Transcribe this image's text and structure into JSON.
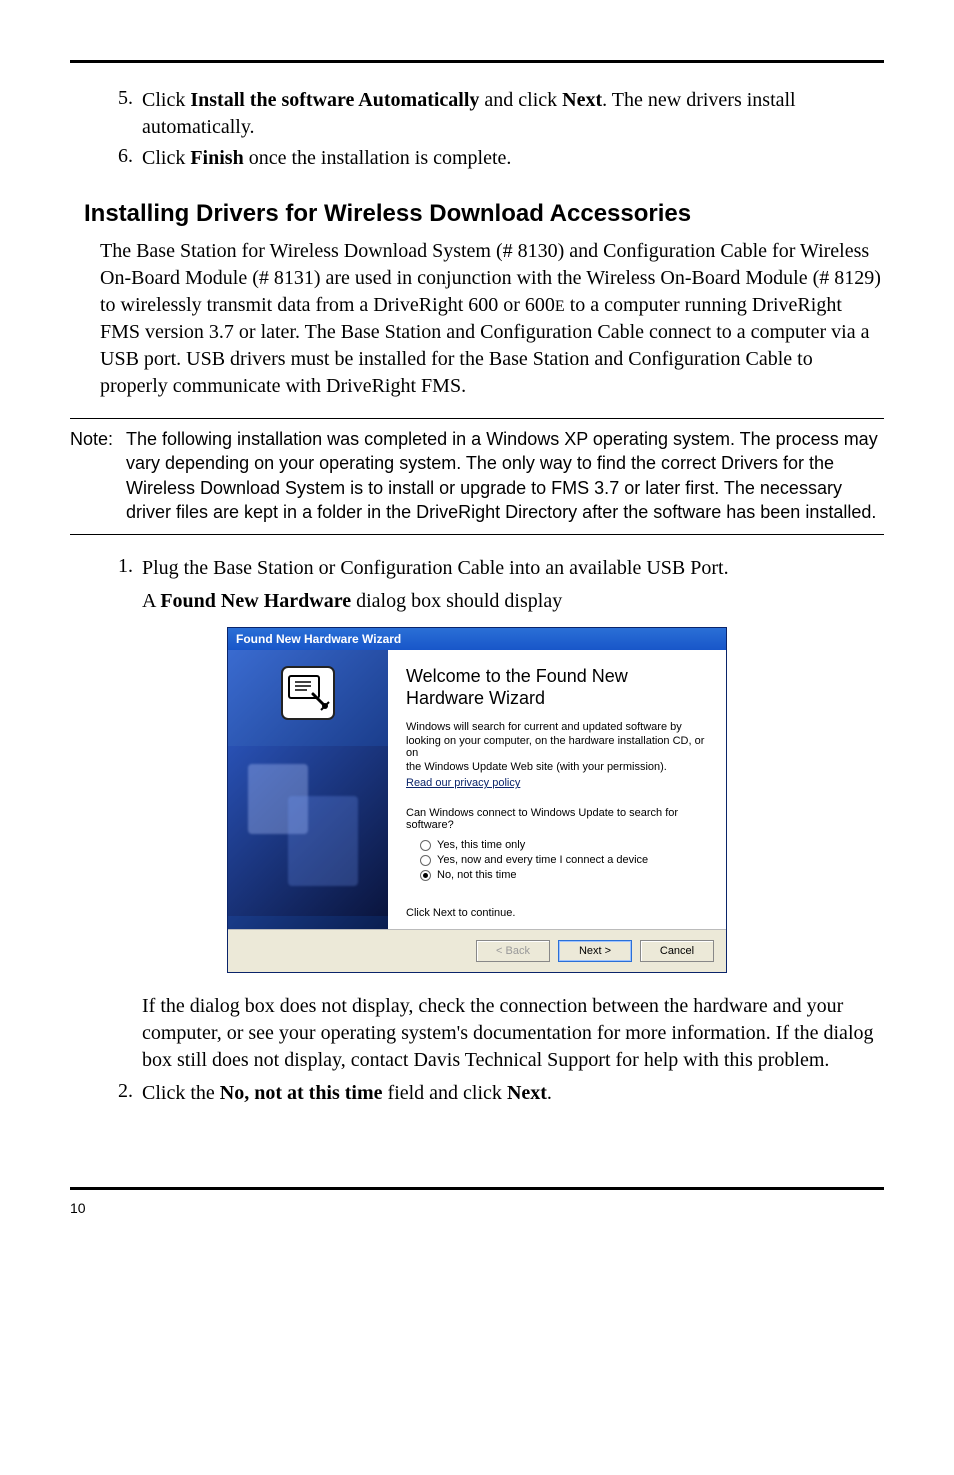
{
  "steps_top": [
    {
      "num": "5.",
      "prefix": "Click ",
      "b1": "Install the software Automatically",
      "mid": " and click ",
      "b2": "Next",
      "suffix": ". The new drivers install automatically."
    },
    {
      "num": "6.",
      "prefix": "Click ",
      "b1": "Finish",
      "mid": " once the installation is complete.",
      "b2": "",
      "suffix": ""
    }
  ],
  "heading": "Installing Drivers for Wireless Download Accessories",
  "paragraph": {
    "p1": "The Base Station for Wireless Download System (# 8130) and Configuration Cable for Wireless On-Board Module (# 8131) are used in conjunction with the Wireless On-Board Module (# 8129) to wirelessly transmit data from a DriveRight 600 or 600",
    "small": "E",
    "p2": " to a computer running DriveRight FMS version 3.7 or later. The Base Station and Configuration Cable connect to a computer via a USB port. USB drivers must be installed for the Base Station and Configuration Cable to properly communicate with DriveRight FMS."
  },
  "note": {
    "label": "Note:",
    "text": "The following installation was completed in a Windows XP operating system. The process may vary depending on your operating system. The only way to find the correct Drivers for the Wireless Download System is to install or upgrade to FMS 3.7 or later first. The necessary driver files are kept in a folder in the DriveRight Directory after the software has been installed."
  },
  "step1": {
    "num": "1.",
    "text": "Plug the Base Station or Configuration Cable into an available USB Port.",
    "sub_pre": "A ",
    "sub_b": "Found New Hardware",
    "sub_post": " dialog box should display"
  },
  "wizard": {
    "title": "Found New Hardware Wizard",
    "h1a": "Welcome to the Found New",
    "h1b": "Hardware Wizard",
    "p1": "Windows will search for current and updated software by",
    "p2": "looking on your computer, on the hardware installation CD, or on",
    "p3": "the Windows Update Web site (with your permission).",
    "link": "Read our privacy policy",
    "q1": "Can Windows connect to Windows Update to search for",
    "q2": "software?",
    "opt1": "Yes, this time only",
    "opt2": "Yes, now and every time I connect a device",
    "opt3": "No, not this time",
    "cont": "Click Next to continue.",
    "back": "< Back",
    "next": "Next >",
    "cancel": "Cancel"
  },
  "followup": "If the dialog box does not display, check the connection between the hardware and your computer, or see your operating system's documentation for more information. If the dialog box still does not display, contact Davis Technical Support for help with this problem.",
  "step2": {
    "num": "2.",
    "pre": "Click the ",
    "b1": "No, not at this time",
    "mid": " field and click ",
    "b2": "Next",
    "suf": "."
  },
  "page_number": "10"
}
